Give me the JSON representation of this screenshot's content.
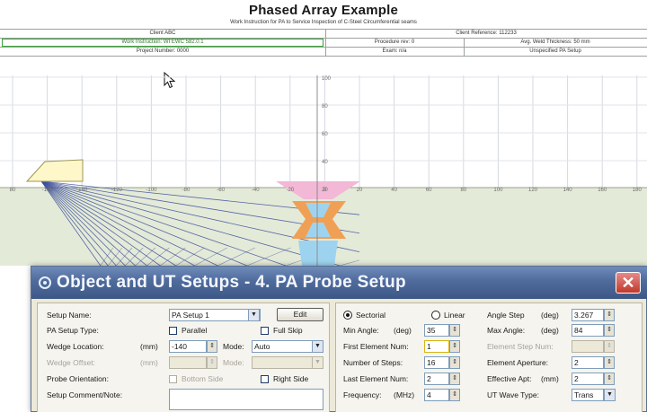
{
  "header": {
    "title": "Phased Array Example",
    "subtitle": "Work Instruction for PA to Service Inspection of C-Steel Circumferential seams",
    "client": "Client ABC",
    "client_reference": "Client Reference: 112233",
    "work_instruction": "Work Instruction: WI EWC 582.0.1",
    "procedure": "Procedure rev: 0",
    "wall_thickness": "Avg. Weld Thickness: 50 mm",
    "project_number": "Project Number: 0000",
    "exam": "Exam: n/a",
    "setup_state": "Unspecified PA Setup"
  },
  "axis": {
    "x_ticks": [
      "80",
      "-160",
      "-140",
      "-120",
      "-100",
      "-80",
      "-60",
      "-40",
      "-20",
      "0",
      "20",
      "40",
      "60",
      "80",
      "100",
      "120",
      "140",
      "160",
      "180"
    ],
    "y_ticks": [
      "100",
      "80",
      "60",
      "40",
      "20"
    ]
  },
  "colors": {
    "weld_top": "#f2b8d6",
    "weld_bottom": "#f0a055",
    "weld_root": "#9ed3ef",
    "plate": "#e4ead8",
    "probe": "#fdf7c9",
    "beam_lines": "#3c4f9a",
    "title_bar": "#4f6b9c"
  },
  "dialog": {
    "title": "Object and UT Setups - 4. PA Probe Setup",
    "close_label": "✕",
    "left": {
      "setup_name_label": "Setup Name:",
      "setup_name_value": "PA Setup 1",
      "edit_button": "Edit",
      "pa_setup_type_label": "PA Setup Type:",
      "parallel_label": "Parallel",
      "full_skip_label": "Full Skip",
      "wedge_location_label": "Wedge Location:",
      "wedge_location_unit": "(mm)",
      "wedge_location_value": "-140",
      "mode_label": "Mode:",
      "mode_value": "Auto",
      "wedge_offset_label": "Wedge Offset:",
      "wedge_offset_unit": "(mm)",
      "mode2_label": "Mode:",
      "probe_orientation_label": "Probe Orientation:",
      "bottom_side_label": "Bottom Side",
      "right_side_label": "Right Side",
      "setup_comment_label": "Setup Comment/Note:"
    },
    "right": {
      "sectorial_label": "Sectorial",
      "linear_label": "Linear",
      "min_angle_label": "Min Angle:",
      "min_angle_unit": "(deg)",
      "min_angle_value": "35",
      "first_element_label": "First Element Num:",
      "first_element_value": "1",
      "number_of_steps_label": "Number of Steps:",
      "number_of_steps_value": "16",
      "last_element_label": "Last Element Num:",
      "last_element_value": "2",
      "frequency_label": "Frequency:",
      "frequency_unit": "(MHz)",
      "frequency_value": "4",
      "angle_step_label": "Angle Step",
      "angle_step_unit": "(deg)",
      "angle_step_value": "3.267",
      "max_angle_label": "Max Angle:",
      "max_angle_unit": "(deg)",
      "max_angle_value": "84",
      "element_step_label": "Element Step Num:",
      "element_aperture_label": "Element Aperture:",
      "element_aperture_value": "2",
      "effective_apt_label": "Effective Apt:",
      "effective_apt_unit": "(mm)",
      "effective_apt_value": "2",
      "ut_wave_type_label": "UT Wave Type:",
      "ut_wave_type_value": "Trans"
    }
  }
}
